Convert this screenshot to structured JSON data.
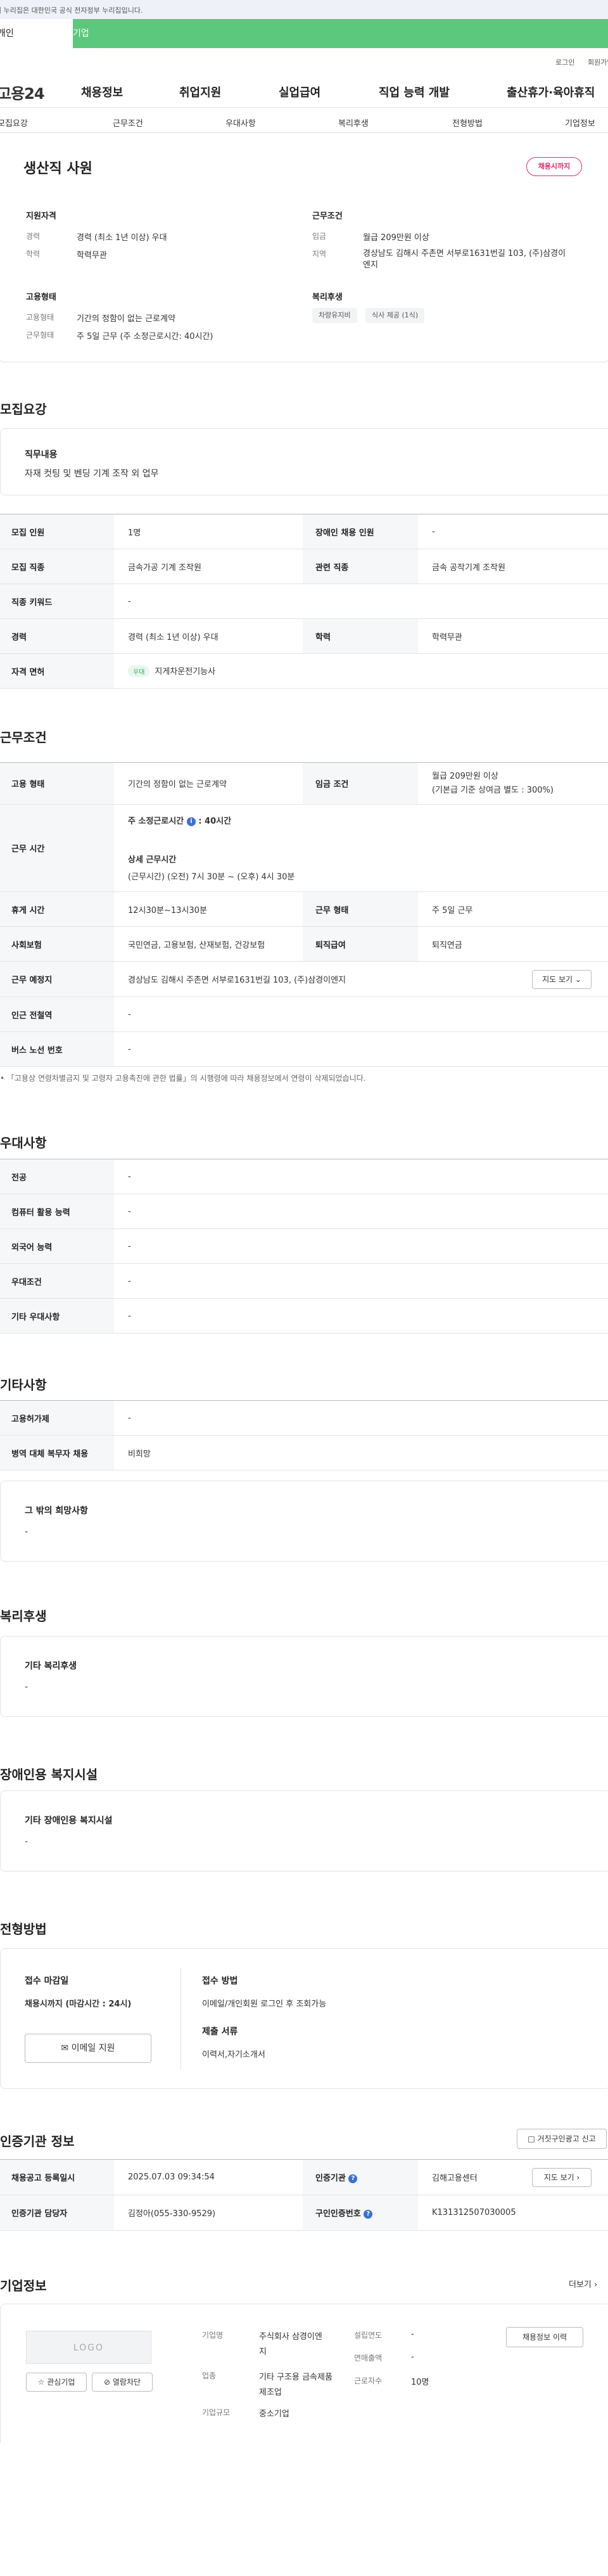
{
  "banner": {
    "text": "이 누리집은 대한민국 공식 전자정부 누리집입니다."
  },
  "user_tabs": [
    "개인",
    "기업"
  ],
  "util": {
    "login": "로그인",
    "join": "회원가입"
  },
  "gnb": {
    "logo": "고용24",
    "menu": [
      "채용정보",
      "취업지원",
      "실업급여",
      "직업 능력 개발",
      "출산휴가·육아휴직"
    ]
  },
  "anchor_tabs": [
    "모집요강",
    "근무조건",
    "우대사항",
    "복리후생",
    "전형방법",
    "기업정보"
  ],
  "summary": {
    "title": "생산직 사원",
    "deadline_badge": "채용시까지",
    "qual_header": "지원자격",
    "qual_rows": [
      {
        "k": "경력",
        "v": "경력 (최소 1년 이상) 우대"
      },
      {
        "k": "학력",
        "v": "학력무관"
      }
    ],
    "emp_header": "고용형태",
    "emp_rows": [
      {
        "k": "고용형태",
        "v": "기간의 정함이 없는 근로계약"
      },
      {
        "k": "근무형태",
        "v": "주 5일 근무 (주 소정근로시간: 40시간)"
      }
    ],
    "cond_header": "근무조건",
    "cond_rows": [
      {
        "k": "임금",
        "v": "월급 209만원 이상"
      },
      {
        "k": "지역",
        "v": "경상남도 김해시 주촌면 서부로1631번길 103, (주)삼경이엔지"
      }
    ],
    "welfare_header": "복리후생",
    "welfare_chips": [
      "차량유지비",
      "식사 제공 (1식)"
    ]
  },
  "recruit": {
    "title": "모집요강",
    "duty_header": "직무내용",
    "duty_text": "자재 컷팅 및 벤딩 기계 조작 외 업무",
    "rows": [
      {
        "k1": "모집 인원",
        "v1": "1명",
        "k2": "장애인 채용 인원",
        "v2": "-"
      },
      {
        "k1": "모집 직종",
        "v1": "금속가공 기계 조작원",
        "k2": "관련 직종",
        "v2": "금속 공작기계 조작원"
      },
      {
        "k1": "직종 키워드",
        "v1": "-"
      },
      {
        "k1": "경력",
        "v1": "경력 (최소 1년 이상) 우대",
        "k2": "학력",
        "v2": "학력무관"
      },
      {
        "k1": "자격 면허",
        "v1": "지게차운전기능사",
        "tag": "우대"
      }
    ]
  },
  "work": {
    "title": "근무조건",
    "emp_k": "고용 형태",
    "emp_v": "기간의 정함이 없는 근로계약",
    "wage_k": "임금 조건",
    "wage_v1": "월급 209만원 이상",
    "wage_v2": "(기본급 기준 상여금 별도 : 300%)",
    "hours_k": "근무 시간",
    "hours_label": "주 소정근로시간",
    "hours_value": "40시간",
    "detail_label": "상세 근무시간",
    "detail_value": "(근무시간) (오전) 7시 30분 ~ (오후) 4시 30분",
    "break_k": "휴게 시간",
    "break_v": "12시30분~13시30분",
    "shift_k": "근무 형태",
    "shift_v": "주 5일 근무",
    "ins_k": "사회보험",
    "ins_v": "국민연금, 고용보험, 산재보험, 건강보험",
    "ret_k": "퇴직급여",
    "ret_v": "퇴직연금",
    "place_k": "근무 예정지",
    "place_v": "경상남도 김해시 주촌면 서부로1631번길 103, (주)삼경이엔지",
    "map_btn": "지도 보기",
    "station_k": "인근 전철역",
    "station_v": "-",
    "bus_k": "버스 노선 번호",
    "bus_v": "-",
    "note": "「고용상 연령차별금지 및 고령자 고용촉진에 관한 법률」의 시행령에 따라 채용정보에서 연령이 삭제되었습니다."
  },
  "pref": {
    "title": "우대사항",
    "rows": [
      {
        "k": "전공",
        "v": "-"
      },
      {
        "k": "컴퓨터 활용 능력",
        "v": "-"
      },
      {
        "k": "외국어 능력",
        "v": "-"
      },
      {
        "k": "우대조건",
        "v": "-"
      },
      {
        "k": "기타 우대사항",
        "v": "-"
      }
    ]
  },
  "etc": {
    "title": "기타사항",
    "rows": [
      {
        "k": "고용허가제",
        "v": "-"
      },
      {
        "k": "병역 대체 복무자 채용",
        "v": "비희망"
      }
    ],
    "hope_header": "그 밖의 희망사항",
    "hope_value": "-"
  },
  "welfare": {
    "title": "복리후생",
    "header": "기타 복리후생",
    "value": "-"
  },
  "disabled": {
    "title": "장애인용 복지시설",
    "header": "기타 장애인용 복지시설",
    "value": "-"
  },
  "process": {
    "title": "전형방법",
    "deadline_header": "접수 마감일",
    "deadline_value": "채용시까지 (마감시간 : 24시)",
    "email_btn": "이메일 지원",
    "method_header": "접수 방법",
    "method_value": "이메일/개인회원 로그인 후 조회가능",
    "docs_header": "제출 서류",
    "docs_value": "이력서,자기소개서"
  },
  "agency": {
    "title": "인증기관 정보",
    "report_btn": "거짓구인광고 신고",
    "rows": [
      {
        "k1": "채용공고 등록일시",
        "v1": "2025.07.03 09:34:54",
        "k2": "인증기관",
        "v2": "김해고용센터"
      },
      {
        "k1": "인증기관 담당자",
        "v1": "김정아(055-330-9529)",
        "k2": "구인인증번호",
        "v2": "K131312507030005"
      }
    ],
    "map_btn": "지도 보기"
  },
  "company": {
    "title": "기업정보",
    "more": "더보기",
    "logo_placeholder": "LOGO",
    "interest_btn": "관심기업",
    "block_btn": "열람차단",
    "history_btn": "채용정보 이력",
    "fields": [
      {
        "k": "기업명",
        "v": "주식회사 삼경이엔지"
      },
      {
        "k": "업종",
        "v": "기타 구조용 금속제품 제조업"
      },
      {
        "k": "기업규모",
        "v": "중소기업"
      }
    ],
    "fields2": [
      {
        "k": "설립연도",
        "v": "-"
      },
      {
        "k": "연매출액",
        "v": "-"
      },
      {
        "k": "근로자수",
        "v": "10명"
      }
    ]
  }
}
